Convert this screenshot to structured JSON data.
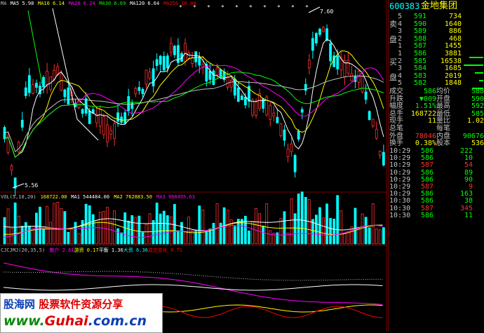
{
  "main_chart": {
    "ma_labels": [
      {
        "text": "MA",
        "color": "#c0c0c0"
      },
      {
        "text": "MA5 5.98",
        "color": "#ffffff"
      },
      {
        "text": "MA10 6.14",
        "color": "#ffff00"
      },
      {
        "text": "MA20 6.24",
        "color": "#ff00ff"
      },
      {
        "text": "MA30 6.69",
        "color": "#00ff00"
      },
      {
        "text": "MA120 6.64",
        "color": "#ffffff"
      },
      {
        "text": "MA250 10.00",
        "color": "#ff0000"
      }
    ],
    "high_price_label": "7.60",
    "low_price_label": "5.56"
  },
  "volume_chart": {
    "labels": [
      {
        "text": "VOL(5,10,20)",
        "color": "#c0c0c0"
      },
      {
        "text": "168722.00",
        "color": "#ffff00"
      },
      {
        "text": "MA1 544484.00",
        "color": "#ffffff"
      },
      {
        "text": "MA2 762883.50",
        "color": "#ffff00"
      },
      {
        "text": "MA3 998495.63",
        "color": "#ff00ff"
      }
    ]
  },
  "indicator_chart": {
    "labels": [
      {
        "text": "CJCJMJ(20,35,5)",
        "color": "#c0c0c0"
      },
      {
        "text": "散户 2.61",
        "color": "#ff00ff"
      },
      {
        "text": "游资 0.17",
        "color": "#ffff00"
      },
      {
        "text": "平衡 1.36",
        "color": "#ffffff"
      },
      {
        "text": "大资 6.36",
        "color": "#00ffff"
      },
      {
        "text": "成交变化 0.71",
        "color": "#ff0000"
      }
    ]
  },
  "quote_panel": {
    "stock_code": "600383",
    "stock_name": "金地集团",
    "sell_label_1": "卖",
    "sell_label_2": "盘",
    "buy_label_1": "买",
    "buy_label_2": "盘",
    "asks": [
      {
        "level": "5",
        "price": "591",
        "volume": "734"
      },
      {
        "level": "4",
        "price": "590",
        "volume": "1640"
      },
      {
        "level": "3",
        "price": "589",
        "volume": "886"
      },
      {
        "level": "2",
        "price": "588",
        "volume": "468"
      },
      {
        "level": "1",
        "price": "587",
        "volume": "1455"
      }
    ],
    "bids": [
      {
        "level": "1",
        "price": "586",
        "volume": "3881"
      },
      {
        "level": "2",
        "price": "585",
        "volume": "16538"
      },
      {
        "level": "3",
        "price": "584",
        "volume": "1685"
      },
      {
        "level": "4",
        "price": "583",
        "volume": "2019"
      },
      {
        "level": "5",
        "price": "582",
        "volume": "1848"
      }
    ],
    "stats": [
      {
        "l1": "成交",
        "v1": "586",
        "l2": "均价",
        "v2": "588",
        "c1": "#00ff00",
        "c2": "#00ff00"
      },
      {
        "l1": "升跌",
        "v1": "▼009",
        "l2": "开盘",
        "v2": "590",
        "c1": "#00ff00",
        "c2": "#00ff00"
      },
      {
        "l1": "幅度",
        "v1": "1.51%",
        "l2": "最高",
        "v2": "592",
        "c1": "#00ff00",
        "c2": "#00ff00"
      },
      {
        "l1": "总手",
        "v1": "168722",
        "l2": "最低",
        "v2": "585",
        "c1": "#ffff00",
        "c2": "#00ff00"
      },
      {
        "l1": "现手",
        "v1": "11",
        "l2": "量比",
        "v2": "1.02",
        "c1": "#ffff00",
        "c2": "#ffff00"
      },
      {
        "l1": "总笔",
        "v1": "",
        "l2": "每笔",
        "v2": "",
        "c1": "#ffff00",
        "c2": "#ffff00"
      },
      {
        "l1": "外盘",
        "v1": "78046",
        "l2": "内盘",
        "v2": "90676",
        "c1": "#ff3030",
        "c2": "#00ff00"
      },
      {
        "l1": "换手",
        "v1": "0.38%",
        "l2": "股本",
        "v2": "536",
        "c1": "#ffff00",
        "c2": "#ffff00"
      }
    ],
    "ticks": [
      {
        "time": "10:29",
        "price": "586",
        "volume": "222",
        "color": "#00ff00"
      },
      {
        "time": "10:29",
        "price": "586",
        "volume": "10",
        "color": "#00ff00"
      },
      {
        "time": "10:29",
        "price": "587",
        "volume": "54",
        "color": "#ff3030"
      },
      {
        "time": "10:29",
        "price": "586",
        "volume": "89",
        "color": "#00ff00"
      },
      {
        "time": "10:29",
        "price": "586",
        "volume": "90",
        "color": "#00ff00"
      },
      {
        "time": "10:29",
        "price": "587",
        "volume": "9",
        "color": "#ff3030"
      },
      {
        "time": "10:29",
        "price": "586",
        "volume": "163",
        "color": "#00ff00"
      },
      {
        "time": "10:30",
        "price": "586",
        "volume": "38",
        "color": "#00ff00"
      },
      {
        "time": "10:30",
        "price": "587",
        "volume": "345",
        "color": "#ff3030"
      },
      {
        "time": "10:30",
        "price": "586",
        "volume": "11",
        "color": "#00ff00"
      }
    ]
  },
  "watermark": {
    "site_name": "股海网",
    "slogan": "股票软件资源分享",
    "url_www": "www.",
    "url_domain": "Guhai",
    "url_tld": ".com.cn"
  }
}
